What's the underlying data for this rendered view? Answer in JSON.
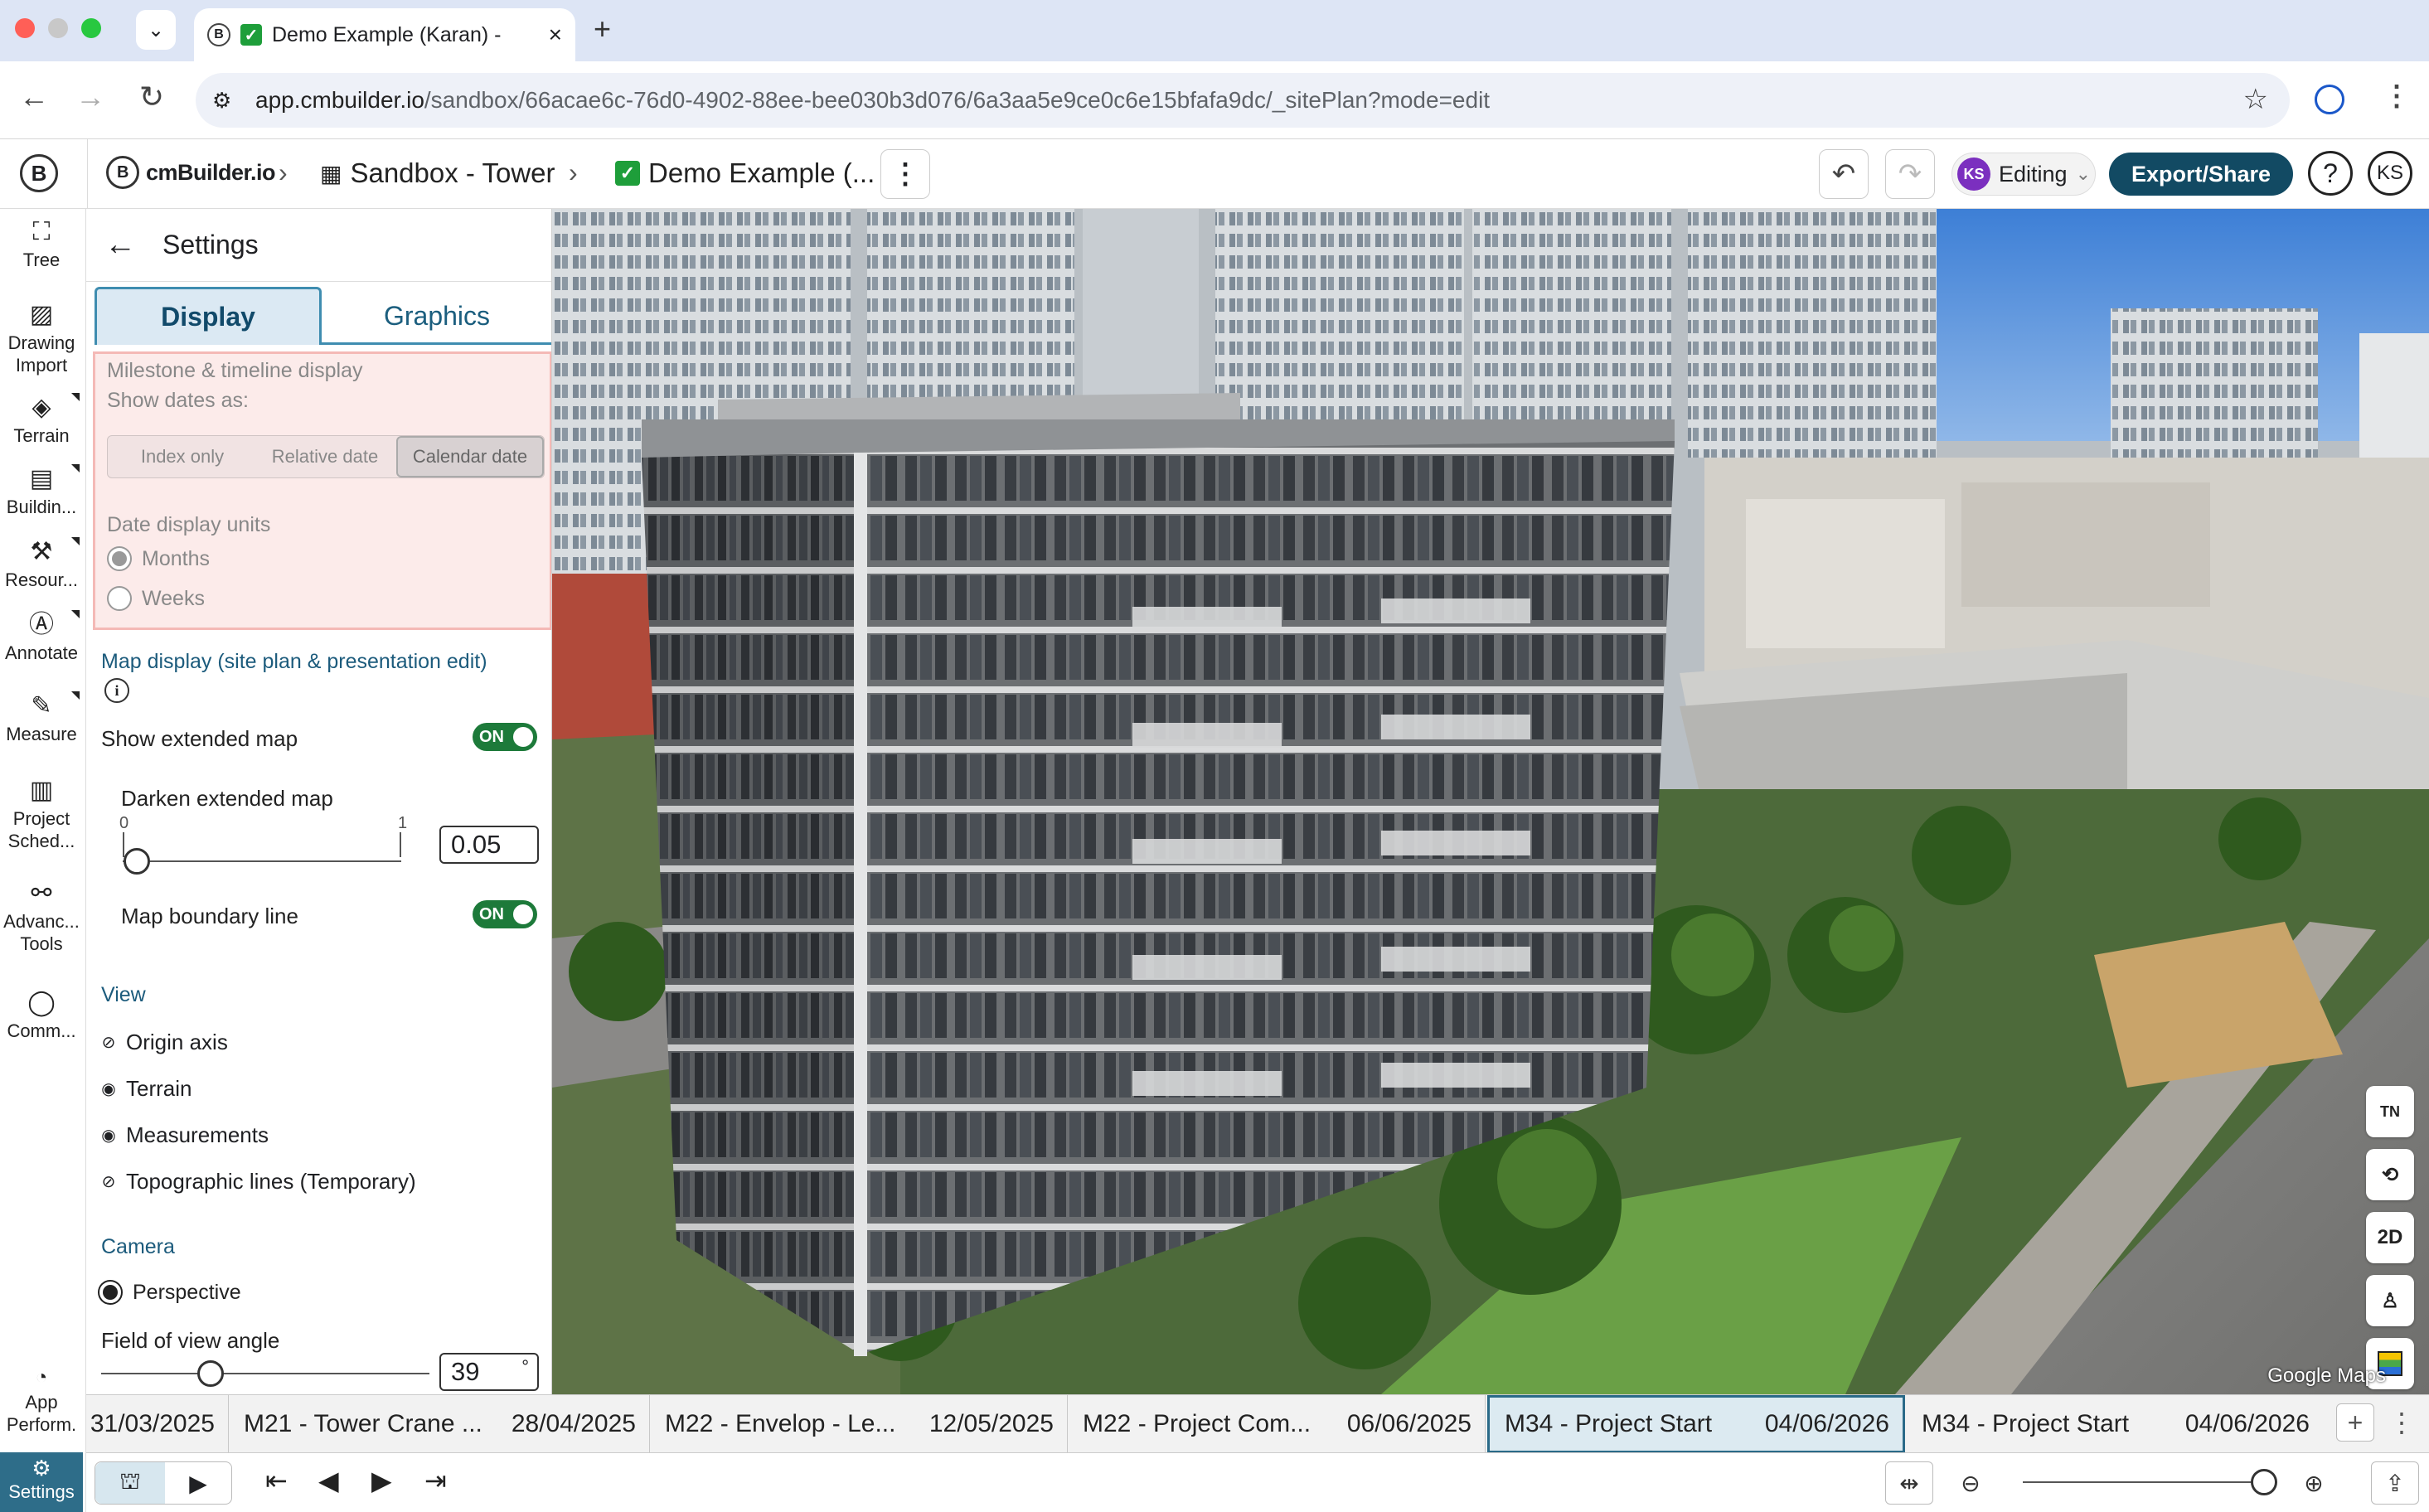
{
  "browser": {
    "tab_title": "Demo Example (Karan) -",
    "url_host": "app.cmbuilder.io",
    "url_path": "/sandbox/66acae6c-76d0-4902-88ee-bee030b3d076/6a3aa5e9ce0c6e15bfafa9dc/_sitePlan?mode=edit"
  },
  "header": {
    "brand": "cmBuilder.io",
    "crumb1": "Sandbox - Tower",
    "crumb2": "Demo Example (...",
    "editing_label": "Editing",
    "editing_avatar": "KS",
    "export_label": "Export/Share",
    "help": "?",
    "user_initials": "KS"
  },
  "rail": {
    "tree": "Tree",
    "drawing_import": "Drawing Import",
    "terrain": "Terrain",
    "building": "Buildin...",
    "resources": "Resour...",
    "annotate": "Annotate",
    "measure": "Measure",
    "project_schedule": "Project Sched...",
    "advanced_tools": "Advanc... Tools",
    "comments": "Comm...",
    "app_performance": "App Perform.",
    "settings": "Settings"
  },
  "settings": {
    "title": "Settings",
    "tabs": [
      "Display",
      "Graphics"
    ],
    "milestone_title": "Milestone & timeline display",
    "show_dates_label": "Show dates as:",
    "date_options": [
      "Index only",
      "Relative date",
      "Calendar date"
    ],
    "date_selected": "Calendar date",
    "units_label": "Date display units",
    "units_options": [
      "Months",
      "Weeks"
    ],
    "units_selected": "Months",
    "map_title": "Map display (site plan & presentation edit)",
    "show_extended_map": "Show extended map",
    "show_extended_map_state": "ON",
    "darken_label": "Darken extended map",
    "darken_min": "0",
    "darken_max": "1",
    "darken_value": "0.05",
    "darken_fraction": 0.05,
    "boundary_label": "Map boundary line",
    "boundary_state": "ON",
    "view_title": "View",
    "view_items": [
      {
        "label": "Origin axis",
        "visible": false
      },
      {
        "label": "Terrain",
        "visible": true
      },
      {
        "label": "Measurements",
        "visible": true
      },
      {
        "label": "Topographic lines (Temporary)",
        "visible": false
      }
    ],
    "camera_title": "Camera",
    "camera_mode": "Perspective",
    "fov_label": "Field of view angle",
    "fov_value": "39",
    "fov_unit": "°"
  },
  "viewport": {
    "attribution": "Google Maps",
    "tools": [
      "TN",
      "2D"
    ]
  },
  "timeline": {
    "milestones": [
      {
        "name": "",
        "date": "31/03/2025"
      },
      {
        "name": "M21 - Tower Crane ...",
        "date": "28/04/2025"
      },
      {
        "name": "M22 - Envelop - Le...",
        "date": "12/05/2025"
      },
      {
        "name": "M22 - Project Com...",
        "date": "06/06/2025"
      },
      {
        "name": "M34 - Project Start",
        "date": "04/06/2026"
      },
      {
        "name": "M34 - Project Start",
        "date": "04/06/2026"
      }
    ],
    "selected_index": 4,
    "zoom_fraction": 0.97
  },
  "colors": {
    "accent": "#124a63",
    "toggle_on": "#1d7a3a",
    "milestone_bg": "#fcebea"
  }
}
